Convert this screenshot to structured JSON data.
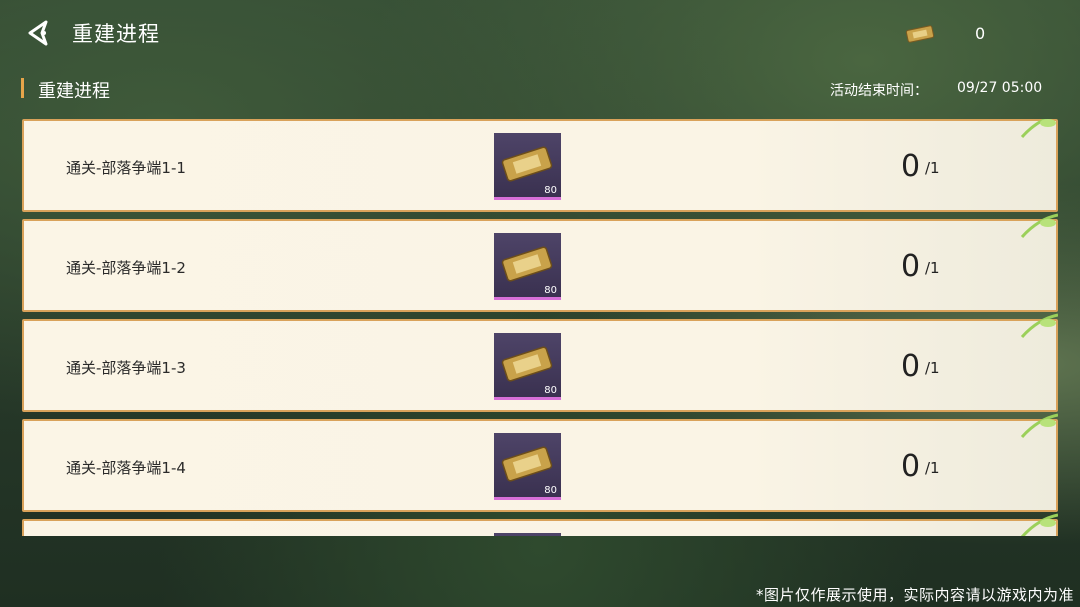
{
  "header": {
    "title": "重建进程",
    "currency_value": "0"
  },
  "section": {
    "title": "重建进程",
    "end_time_label": "活动结束时间：",
    "end_time_value": "09/27 05:00"
  },
  "tasks": [
    {
      "name": "通关-部落争端1-1",
      "reward_count": "80",
      "progress": "0",
      "total": "/1"
    },
    {
      "name": "通关-部落争端1-2",
      "reward_count": "80",
      "progress": "0",
      "total": "/1"
    },
    {
      "name": "通关-部落争端1-3",
      "reward_count": "80",
      "progress": "0",
      "total": "/1"
    },
    {
      "name": "通关-部落争端1-4",
      "reward_count": "80",
      "progress": "0",
      "total": "/1"
    }
  ],
  "reward_icon": "coupon-ticket-icon",
  "disclaimer": "*图片仅作展示使用，实际内容请以游戏内为准",
  "colors": {
    "card_border": "#d9a25a",
    "section_accent": "#e7a54a",
    "reward_frame": "#4e4468",
    "reward_rarity": "#d66fd8"
  }
}
